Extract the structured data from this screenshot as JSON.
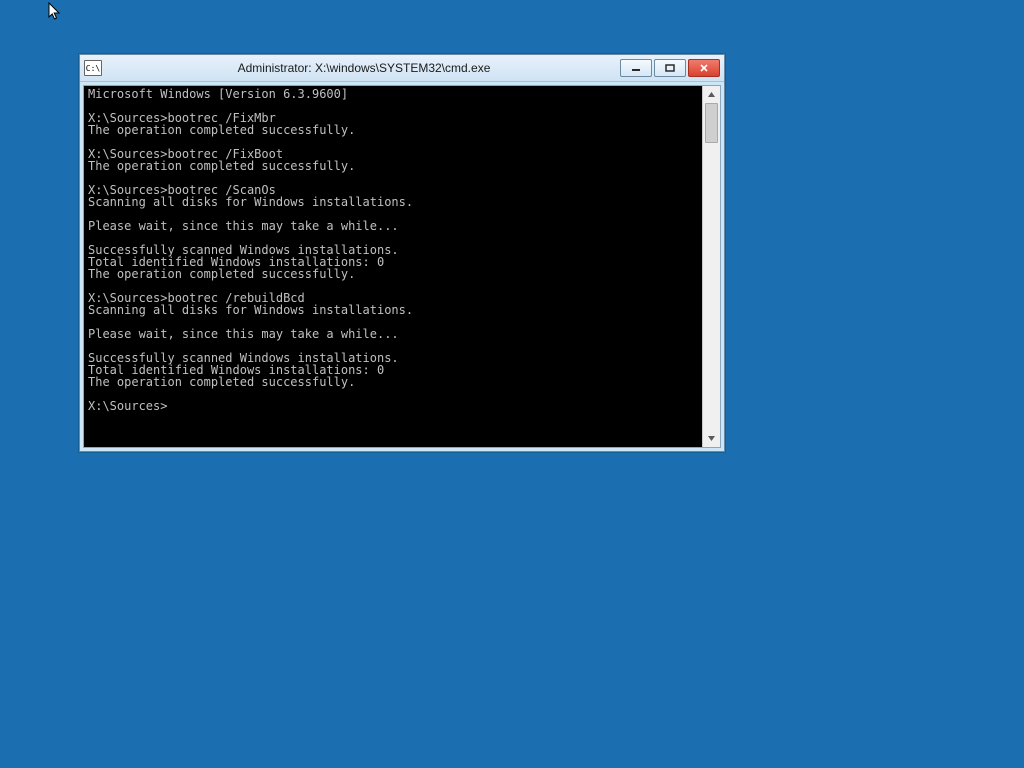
{
  "window": {
    "title": "Administrator: X:\\windows\\SYSTEM32\\cmd.exe",
    "icon_label": "C:\\"
  },
  "console": {
    "lines": [
      "Microsoft Windows [Version 6.3.9600]",
      "",
      "X:\\Sources>bootrec /FixMbr",
      "The operation completed successfully.",
      "",
      "X:\\Sources>bootrec /FixBoot",
      "The operation completed successfully.",
      "",
      "X:\\Sources>bootrec /ScanOs",
      "Scanning all disks for Windows installations.",
      "",
      "Please wait, since this may take a while...",
      "",
      "Successfully scanned Windows installations.",
      "Total identified Windows installations: 0",
      "The operation completed successfully.",
      "",
      "X:\\Sources>bootrec /rebuildBcd",
      "Scanning all disks for Windows installations.",
      "",
      "Please wait, since this may take a while...",
      "",
      "Successfully scanned Windows installations.",
      "Total identified Windows installations: 0",
      "The operation completed successfully.",
      "",
      "X:\\Sources>"
    ]
  }
}
